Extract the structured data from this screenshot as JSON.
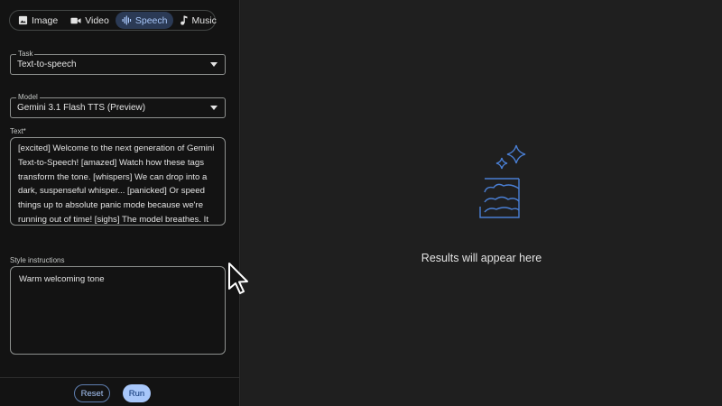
{
  "tabs": [
    {
      "label": "Image",
      "icon": "image-icon"
    },
    {
      "label": "Video",
      "icon": "video-icon"
    },
    {
      "label": "Speech",
      "icon": "speech-icon",
      "active": true
    },
    {
      "label": "Music",
      "icon": "music-icon"
    }
  ],
  "task": {
    "label": "Task",
    "value": "Text-to-speech"
  },
  "model": {
    "label": "Model",
    "value": "Gemini 3.1 Flash TTS (Preview)"
  },
  "text": {
    "label": "Text*",
    "value": "[excited] Welcome to the next generation of Gemini Text-to-Speech! [amazed] Watch how these tags transform the tone. [whispers] We can drop into a dark, suspenseful whisper... [panicked] Or speed things up to absolute panic mode because we're running out of time! [sighs] The model breathes. It even laughs! [laughs] The best part is being able to"
  },
  "style": {
    "label": "Style instructions",
    "value": "Warm welcoming tone"
  },
  "actions": {
    "reset_label": "Reset",
    "run_label": "Run"
  },
  "results": {
    "placeholder": "Results will appear here"
  },
  "colors": {
    "accent": "#a8c7fa",
    "active_tab_bg": "#2b3a55",
    "panel_bg": "#131313",
    "main_bg": "#1f1f1f",
    "icon_blue": "#4a7fd4"
  }
}
